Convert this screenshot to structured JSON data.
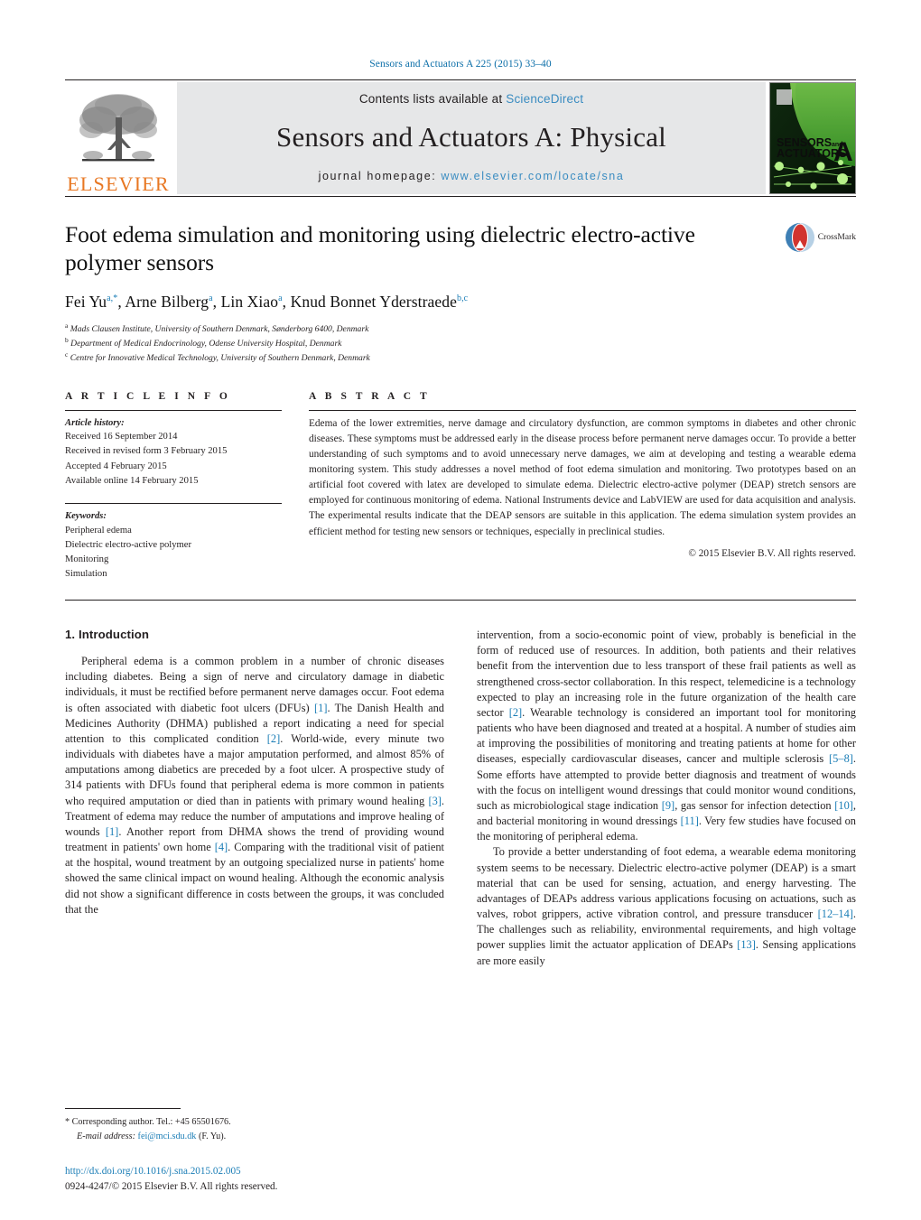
{
  "running_head": "Sensors and Actuators A 225 (2015) 33–40",
  "masthead": {
    "publisher_logo_text": "ELSEVIER",
    "contents_prefix": "Contents lists available at ",
    "contents_link": "ScienceDirect",
    "journal_title": "Sensors and Actuators A: Physical",
    "homepage_prefix": "journal homepage: ",
    "homepage_url": "www.elsevier.com/locate/sna",
    "cover": {
      "line1": "SENSORS",
      "line1_suffix": "and",
      "line2": "ACTUATORS",
      "big_letter": "A"
    }
  },
  "article": {
    "title": "Foot edema simulation and monitoring using dielectric electro-active polymer sensors",
    "crossmark_label": "CrossMark",
    "authors_html": "Fei Yu<sup>a,*</sup>, Arne Bilberg<sup>a</sup>, Lin Xiao<sup>a</sup>, Knud Bonnet Yderstraede<sup>b,c</sup>",
    "affiliations": [
      "<sup>a</sup> Mads Clausen Institute, University of Southern Denmark, Sønderborg 6400, Denmark",
      "<sup>b</sup> Department of Medical Endocrinology, Odense University Hospital, Denmark",
      "<sup>c</sup> Centre for Innovative Medical Technology, University of Southern Denmark, Denmark"
    ]
  },
  "article_info": {
    "heading": "A R T I C L E   I N F O",
    "history_label": "Article history:",
    "history": [
      "Received 16 September 2014",
      "Received in revised form 3 February 2015",
      "Accepted 4 February 2015",
      "Available online 14 February 2015"
    ],
    "keywords_label": "Keywords:",
    "keywords": [
      "Peripheral edema",
      "Dielectric electro-active polymer",
      "Monitoring",
      "Simulation"
    ]
  },
  "abstract": {
    "heading": "A B S T R A C T",
    "text": "Edema of the lower extremities, nerve damage and circulatory dysfunction, are common symptoms in diabetes and other chronic diseases. These symptoms must be addressed early in the disease process before permanent nerve damages occur. To provide a better understanding of such symptoms and to avoid unnecessary nerve damages, we aim at developing and testing a wearable edema monitoring system. This study addresses a novel method of foot edema simulation and monitoring. Two prototypes based on an artificial foot covered with latex are developed to simulate edema. Dielectric electro-active polymer (DEAP) stretch sensors are employed for continuous monitoring of edema. National Instruments device and LabVIEW are used for data acquisition and analysis. The experimental results indicate that the DEAP sensors are suitable in this application. The edema simulation system provides an efficient method for testing new sensors or techniques, especially in preclinical studies.",
    "copyright": "© 2015 Elsevier B.V. All rights reserved."
  },
  "body": {
    "section_number_title": "1.  Introduction",
    "left_paragraphs": [
      "Peripheral edema is a common problem in a number of chronic diseases including diabetes. Being a sign of nerve and circulatory damage in diabetic individuals, it must be rectified before permanent nerve damages occur. Foot edema is often associated with diabetic foot ulcers (DFUs) <span class=\"ref\">[1]</span>. The Danish Health and Medicines Authority (DHMA) published a report indicating a need for special attention to this complicated condition <span class=\"ref\">[2]</span>. World-wide, every minute two individuals with diabetes have a major amputation performed, and almost 85% of amputations among diabetics are preceded by a foot ulcer. A prospective study of 314 patients with DFUs found that peripheral edema is more common in patients who required amputation or died than in patients with primary wound healing <span class=\"ref\">[3]</span>. Treatment of edema may reduce the number of amputations and improve healing of wounds <span class=\"ref\">[1]</span>. Another report from DHMA shows the trend of providing wound treatment in patients' own home <span class=\"ref\">[4]</span>. Comparing with the traditional visit of patient at the hospital, wound treatment by an outgoing specialized nurse in patients' home showed the same clinical impact on wound healing. Although the economic analysis did not show a significant difference in costs between the groups, it was concluded that the"
    ],
    "right_paragraphs": [
      "intervention, from a socio-economic point of view, probably is beneficial in the form of reduced use of resources. In addition, both patients and their relatives benefit from the intervention due to less transport of these frail patients as well as strengthened cross-sector collaboration. In this respect, telemedicine is a technology expected to play an increasing role in the future organization of the health care sector <span class=\"ref\">[2]</span>. Wearable technology is considered an important tool for monitoring patients who have been diagnosed and treated at a hospital. A number of studies aim at improving the possibilities of monitoring and treating patients at home for other diseases, especially cardiovascular diseases, cancer and multiple sclerosis <span class=\"ref\">[5–8]</span>. Some efforts have attempted to provide better diagnosis and treatment of wounds with the focus on intelligent wound dressings that could monitor wound conditions, such as microbiological stage indication <span class=\"ref\">[9]</span>, gas sensor for infection detection <span class=\"ref\">[10]</span>, and bacterial monitoring in wound dressings <span class=\"ref\">[11]</span>. Very few studies have focused on the monitoring of peripheral edema.",
      "To provide a better understanding of foot edema, a wearable edema monitoring system seems to be necessary. Dielectric electro-active polymer (DEAP) is a smart material that can be used for sensing, actuation, and energy harvesting. The advantages of DEAPs address various applications focusing on actuations, such as valves, robot grippers, active vibration control, and pressure transducer <span class=\"ref\">[12–14]</span>. The challenges such as reliability, environmental requirements, and high voltage power supplies limit the actuator application of DEAPs <span class=\"ref\">[13]</span>. Sensing applications are more easily"
    ]
  },
  "footer": {
    "corresponding_marker": "*",
    "corresponding_text": "Corresponding author. Tel.: +45 65501676.",
    "email_label": "E-mail address:",
    "email": "fei@mci.sdu.dk",
    "email_owner": "(F. Yu).",
    "doi_url": "http://dx.doi.org/10.1016/j.sna.2015.02.005",
    "issn_line": "0924-4247/© 2015 Elsevier B.V. All rights reserved."
  },
  "colors": {
    "link_blue": "#1a7db6",
    "header_blue": "#0b6ea8",
    "elsevier_orange": "#e87722",
    "masthead_grey": "#e6e7e8",
    "cover_green": "#3faa35"
  }
}
